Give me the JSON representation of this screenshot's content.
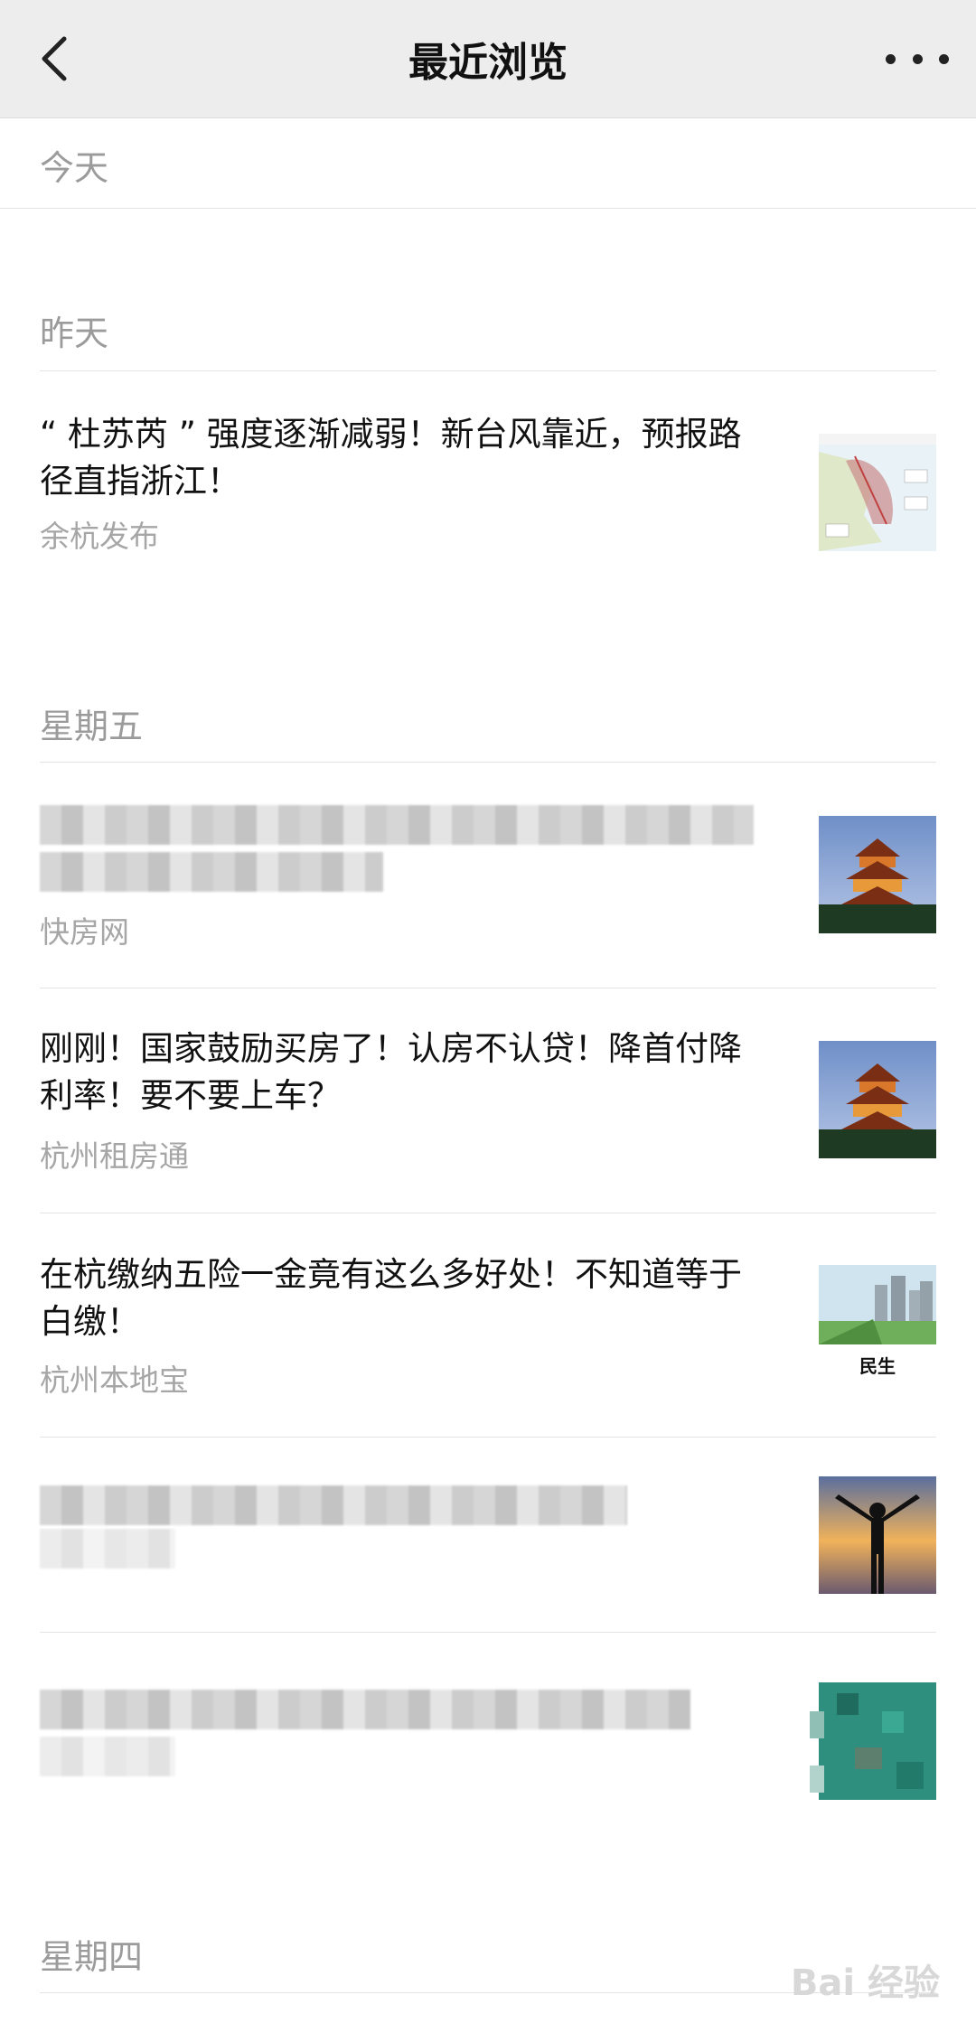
{
  "nav": {
    "title": "最近浏览",
    "back_icon": "chevron-left-icon",
    "more_icon": "more-dots-icon"
  },
  "sections": {
    "today": "今天",
    "yesterday": "昨天",
    "friday": "星期五",
    "thursday": "星期四"
  },
  "articles": [
    {
      "title": "“ 杜苏芮 ” 强度逐渐减弱！新台风靠近，预报路径直指浙江！",
      "source": "余杭发布"
    },
    {
      "title": "",
      "source": "快房网"
    },
    {
      "title": "刚刚！国家鼓励买房了！认房不认贷！降首付降利率！要不要上车？",
      "source": "杭州租房通"
    },
    {
      "title": "在杭缴纳五险一金竟有这么多好处！不知道等于白缴！",
      "source": "杭州本地宝"
    },
    {
      "title": "",
      "source": ""
    },
    {
      "title": "",
      "source": ""
    }
  ],
  "thumbs": {
    "minsheng_label": "民生"
  },
  "watermark": "Bai 经验"
}
